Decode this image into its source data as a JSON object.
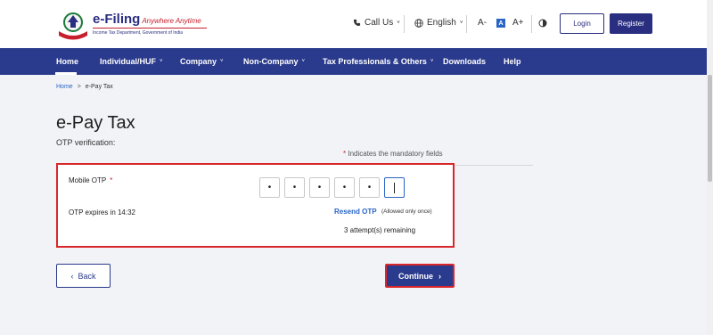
{
  "header": {
    "logo_title": "e-Filing",
    "logo_tagline": "Anywhere Anytime",
    "logo_subtitle": "Income Tax Department, Government of India",
    "call_us": "Call Us",
    "language": "English",
    "text_size": [
      "A-",
      "A",
      "A+"
    ],
    "login": "Login",
    "register": "Register"
  },
  "nav": {
    "items": [
      {
        "label": "Home"
      },
      {
        "label": "Individual/HUF"
      },
      {
        "label": "Company"
      },
      {
        "label": "Non-Company"
      },
      {
        "label": "Tax Professionals & Others"
      },
      {
        "label": "Downloads"
      },
      {
        "label": "Help"
      }
    ]
  },
  "breadcrumb": {
    "home": "Home",
    "separator": ">",
    "current": "e-Pay Tax"
  },
  "page": {
    "title": "e-Pay Tax",
    "subtitle": "OTP verification:",
    "mandatory_star": "*",
    "mandatory_note": "Indicates the mandatory fields"
  },
  "otp": {
    "label": "Mobile OTP",
    "required_star": "*",
    "digits": [
      "•",
      "•",
      "•",
      "•",
      "•",
      ""
    ],
    "expires": "OTP expires in 14:32",
    "resend": "Resend OTP",
    "allowed": "(Allowed only once)",
    "attempts": "3 attempt(s) remaining"
  },
  "actions": {
    "back": "Back",
    "continue": "Continue"
  },
  "colors": {
    "brand_blue": "#2a3a8c",
    "link_blue": "#2a64c5",
    "highlight_red": "#d9262a"
  }
}
